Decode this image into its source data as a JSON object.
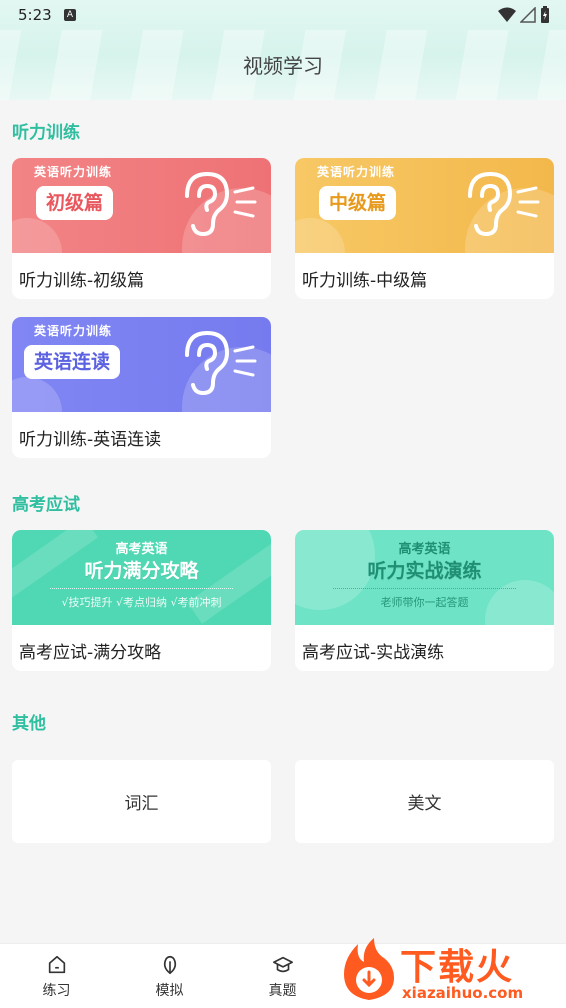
{
  "status": {
    "time": "5:23",
    "badge": "A"
  },
  "header": {
    "title": "视频学习"
  },
  "sections": {
    "listening": {
      "title": "听力训练",
      "cards": [
        {
          "banner_top": "英语听力训练",
          "banner_pill": "初级篇",
          "label": "听力训练-初级篇",
          "color": "#f07a7d",
          "pill_text_color": "#e8585e"
        },
        {
          "banner_top": "英语听力训练",
          "banner_pill": "中级篇",
          "label": "听力训练-中级篇",
          "color": "#f5c05a",
          "pill_text_color": "#e79a1c"
        },
        {
          "banner_top": "英语听力训练",
          "banner_pill": "英语连读",
          "label": "听力训练-英语连读",
          "color": "#7c82f3",
          "pill_text_color": "#5b61e0"
        }
      ]
    },
    "gaokao": {
      "title": "高考应试",
      "cards": [
        {
          "banner_top": "高考英语",
          "banner_main": "听力满分攻略",
          "banner_sub": "√技巧提升   √考点归纳   √考前冲刺",
          "label": "高考应试-满分攻略",
          "color": "#52d9b5"
        },
        {
          "banner_top": "高考英语",
          "banner_main": "听力实战演练",
          "banner_sub": "老师带你一起答题",
          "label": "高考应试-实战演练",
          "color": "#6ee3c6"
        }
      ]
    },
    "other": {
      "title": "其他",
      "cards": [
        {
          "label": "词汇"
        },
        {
          "label": "美文"
        }
      ]
    }
  },
  "tabbar": {
    "tabs": [
      {
        "label": "练习",
        "icon": "home-icon"
      },
      {
        "label": "模拟",
        "icon": "leaf-icon"
      },
      {
        "label": "真题",
        "icon": "graduation-cap-icon"
      }
    ]
  },
  "watermark": {
    "main": "下载火",
    "sub": "xiazaihuo.com"
  },
  "colors": {
    "accent": "#2fbfa0"
  }
}
